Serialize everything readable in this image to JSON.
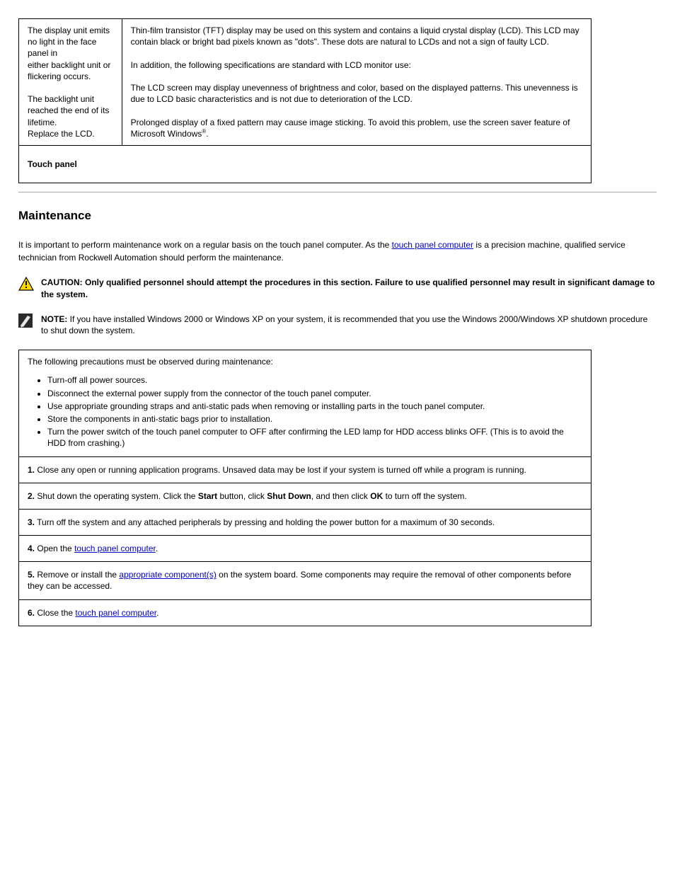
{
  "table1": {
    "cell_a_lines": [
      "The display unit emits no light in the face panel in",
      "either backlight unit or flickering occurs.",
      "The backlight unit reached the end of its lifetime.",
      "Replace the LCD."
    ],
    "cell_b_lines": [
      "Thin-film transistor (TFT) display may be used on this",
      "system and contains a liquid crystal display (LCD).",
      "This LCD may contain black or bright bad pixels known",
      "as \"dots\". These dots are natural to LCDs and not a",
      "sign of faulty LCD.",
      "In addition, the following specifications are standard",
      "with LCD monitor use:",
      "The LCD screen may display unevenness of brightness",
      "and color, based on the displayed patterns. This",
      "unevenness is due to LCD basic characteristics and is not",
      "due to deterioration of the LCD.",
      "Prolonged display of a fixed pattern may cause image",
      "sticking. To avoid this problem, use the screen saver",
      "feature of Microsoft Windows"
    ],
    "note_reg_suffix": ".",
    "cell_c": "Touch panel"
  },
  "section_heading": "Maintenance",
  "intro_para_pre": "It is important to perform maintenance work on a regular basis on the touch panel computer. As the ",
  "intro_link": "touch panel computer",
  "intro_para_post": " is a precision machine, qualified service technician from Rockwell Automation should perform the maintenance.",
  "caution": {
    "label": "CAUTION: ",
    "text": "Only qualified personnel should attempt the procedures in this section. Failure to use qualified personnel may result in significant damage to the system."
  },
  "note": {
    "label": "NOTE: ",
    "text": "If you have installed Windows 2000 or Windows XP on your system, it is recommended that you use the Windows 2000/Windows XP shutdown procedure to shut down the system."
  },
  "precautions": {
    "heading": "The following precautions must be observed during maintenance:",
    "items": [
      "Turn-off all power sources.",
      "Disconnect the external power supply from the connector of the touch panel computer.",
      "Use appropriate grounding straps and anti-static pads when removing or installing parts in the touch panel computer.",
      "Store the components in anti-static bags prior to installation.",
      "Turn the power switch of the touch panel computer to OFF after confirming the LED lamp for HDD access blinks OFF. (This is to avoid the HDD from crashing.)"
    ]
  },
  "steps": [
    {
      "num": "1.",
      "text": "Close any open or running application programs. Unsaved data may be lost if your system is turned off while a program is running."
    },
    {
      "num": "2.",
      "text_pre": "Shut down the operating system. Click the ",
      "bold1": "Start",
      "mid1": " button, click ",
      "bold2": "Shut Down",
      "mid2": ", and then click ",
      "bold3": "OK",
      "post": " to turn off the system."
    },
    {
      "num": "3.",
      "text": "Turn off the system and any attached peripherals by pressing and holding the power button for a maximum of 30 seconds."
    },
    {
      "num": "4.",
      "pre": "Open the ",
      "link": "touch panel computer",
      "post": "."
    },
    {
      "num": "5.",
      "pre": "Remove or install the ",
      "link": "appropriate component(s)",
      "post_line": " on the system board. Some components may require the removal of other components before they can be accessed."
    },
    {
      "num": "6.",
      "pre": "Close the ",
      "link": "touch panel computer",
      "post": "."
    }
  ]
}
